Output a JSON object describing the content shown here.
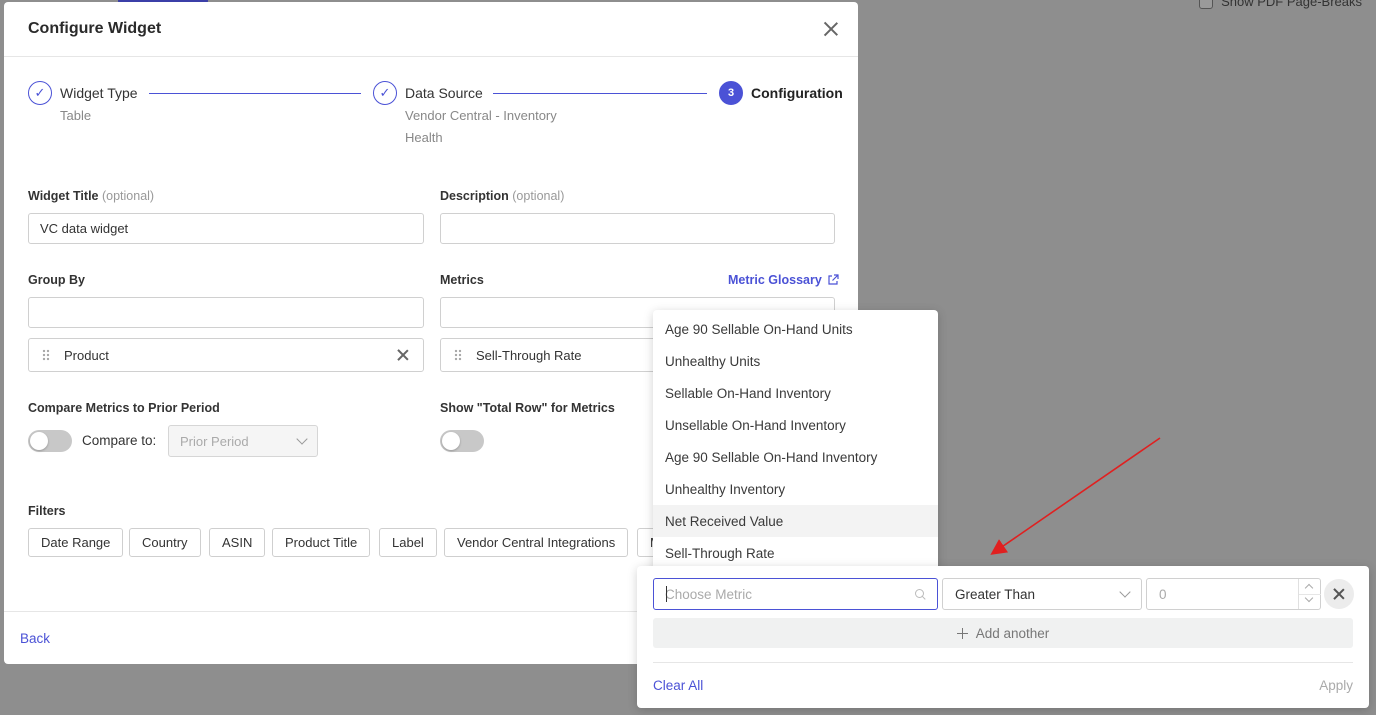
{
  "background": {
    "pdf_label": "Show PDF Page-Breaks"
  },
  "modal": {
    "title": "Configure Widget",
    "steps": [
      {
        "title": "Widget Type",
        "sub": "Table",
        "state": "done"
      },
      {
        "title": "Data Source",
        "sub": "Vendor Central - Inventory Health",
        "state": "done"
      },
      {
        "title": "Configuration",
        "num": "3",
        "state": "active"
      }
    ],
    "widget_title": {
      "label": "Widget Title",
      "optional": "(optional)",
      "value": "VC data widget"
    },
    "description": {
      "label": "Description",
      "optional": "(optional)",
      "value": ""
    },
    "group_by": {
      "label": "Group By",
      "chip": "Product"
    },
    "metrics": {
      "label": "Metrics",
      "glossary": "Metric Glossary",
      "chip": "Sell-Through Rate"
    },
    "compare": {
      "label": "Compare Metrics to Prior Period",
      "compare_to": "Compare to:",
      "select": "Prior Period"
    },
    "total_row": {
      "label": "Show \"Total Row\" for Metrics"
    },
    "filters": {
      "label": "Filters",
      "buttons": [
        "Date Range",
        "Country",
        "ASIN",
        "Product Title",
        "Label",
        "Vendor Central Integrations",
        "Metric"
      ]
    },
    "back": "Back"
  },
  "dropdown": {
    "items": [
      "Age 90 Sellable On-Hand Units",
      "Unhealthy Units",
      "Sellable On-Hand Inventory",
      "Unsellable On-Hand Inventory",
      "Age 90 Sellable On-Hand Inventory",
      "Unhealthy Inventory",
      "Net Received Value",
      "Sell-Through Rate"
    ],
    "hovered": "Net Received Value"
  },
  "filter_panel": {
    "metric_placeholder": "Choose Metric",
    "operator": "Greater Than",
    "value_placeholder": "0",
    "add_another": "Add another",
    "clear_all": "Clear All",
    "apply": "Apply"
  },
  "colors": {
    "accent": "#4b52d6",
    "annotation_arrow": "#e02020"
  }
}
